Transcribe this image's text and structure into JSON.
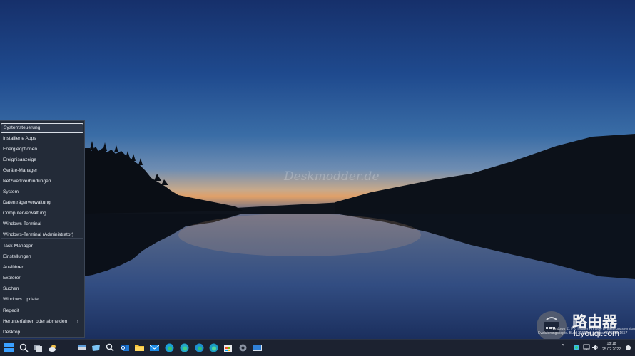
{
  "desktop": {
    "watermark": "Deskmodder.de"
  },
  "context_menu": {
    "items": [
      {
        "label": "Systemsteuerung",
        "selected": true
      },
      {
        "label": "Installierte Apps"
      },
      {
        "label": "Energieoptionen"
      },
      {
        "label": "Ereignisanzeige"
      },
      {
        "label": "Geräte-Manager"
      },
      {
        "label": "Netzwerkverbindungen"
      },
      {
        "label": "System"
      },
      {
        "label": "Datenträgerverwaltung"
      },
      {
        "label": "Computerverwaltung"
      },
      {
        "label": "Windows-Terminal"
      },
      {
        "label": "Windows-Terminal (Administrator)"
      },
      {
        "label": "Task-Manager"
      },
      {
        "label": "Einstellungen"
      },
      {
        "label": "Ausführen"
      },
      {
        "label": "Explorer"
      },
      {
        "label": "Suchen"
      },
      {
        "label": "Windows Update"
      },
      {
        "label": "Regedit"
      },
      {
        "label": "Herunterfahren oder abmelden",
        "submenu": true
      },
      {
        "label": "Desktop"
      }
    ],
    "submenu_arrow": "›"
  },
  "overlay": {
    "logo_cn": "路由器",
    "logo_en": "luyouqi.com",
    "eval_line1": "Windows 11 Pro Insider Preview Evaluierungsversion",
    "eval_line2": "Evaluierungskopie. Build 22563.ni_release.220219-1657"
  },
  "taskbar": {
    "clock_time": "18:18",
    "clock_date": "25.02.2022",
    "tray_chevron": "^",
    "icons": [
      "start-icon",
      "search-icon",
      "task-view-icon",
      "widgets-icon",
      "app-icon-1",
      "app-icon-2",
      "search-app-icon",
      "outlook-icon",
      "file-explorer-icon",
      "mail-icon",
      "edge-icon",
      "edge-beta-icon",
      "edge-dev-icon",
      "edge-canary-icon",
      "store-icon",
      "settings-icon",
      "remote-desktop-icon"
    ]
  },
  "colors": {
    "menu_bg": "#232b38",
    "taskbar_bg": "#1c2230",
    "accent": "#0a84ff"
  }
}
